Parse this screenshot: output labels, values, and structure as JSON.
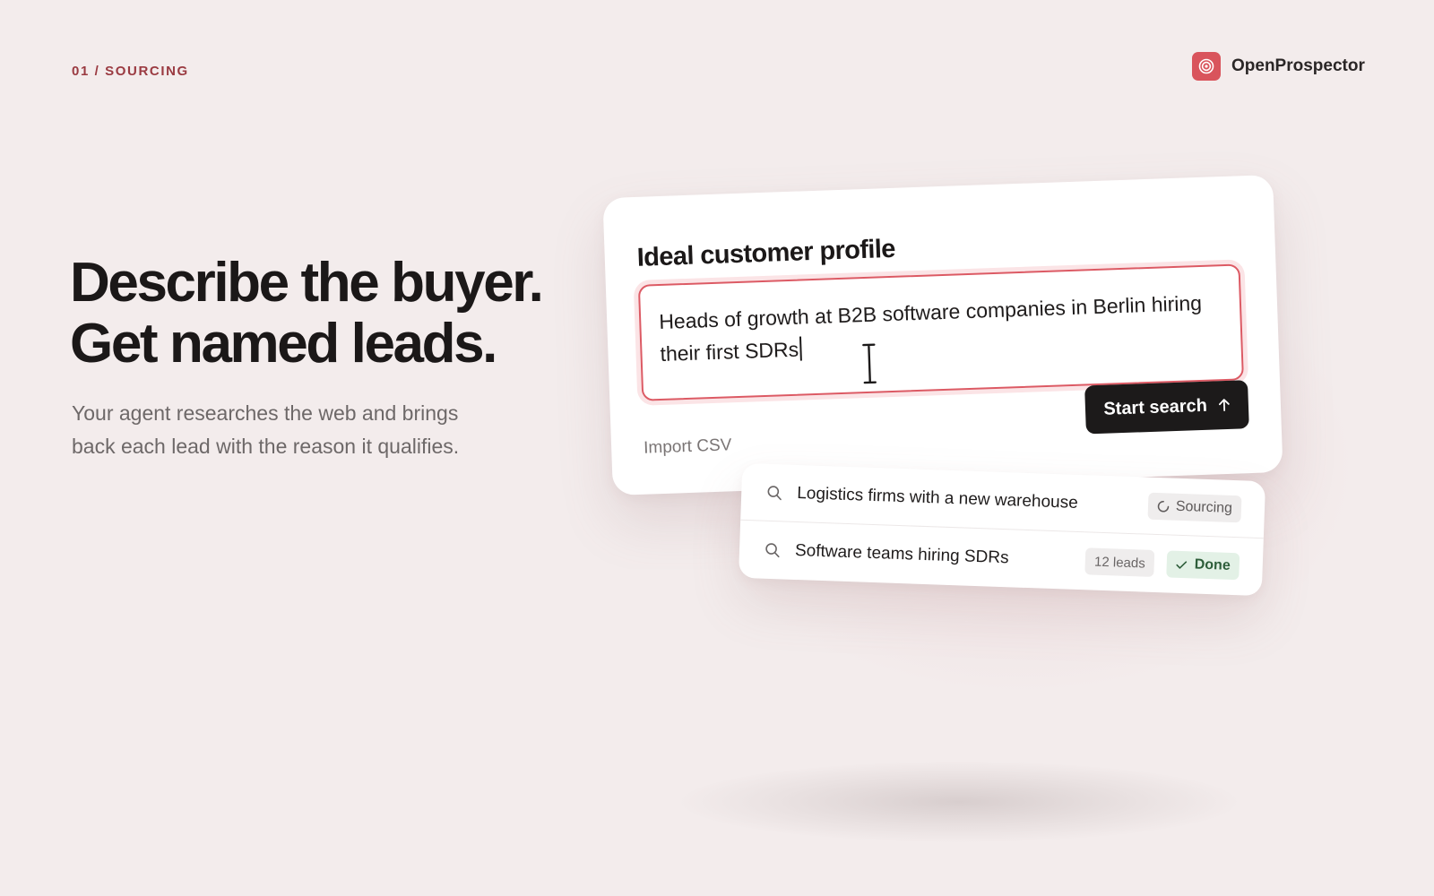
{
  "header": {
    "eyebrow": "01 / SOURCING",
    "brand_name": "OpenProspector",
    "brand_icon": "target-icon",
    "brand_color": "#d9545c"
  },
  "hero": {
    "headline_line1": "Describe the buyer.",
    "headline_line2": "Get named leads.",
    "subcopy": "Your agent researches the web and brings back each lead with the reason it qualifies."
  },
  "icp_card": {
    "title": "Ideal customer profile",
    "input_value": "Heads of growth at B2B software companies in Berlin hiring their first SDRs",
    "import_label": "Import CSV",
    "start_label": "Start search",
    "start_icon": "arrow-up-icon",
    "accent_color": "#dc5a64"
  },
  "searches": [
    {
      "query": "Logistics firms with a new warehouse",
      "status": "Sourcing",
      "status_icon": "spinner-icon"
    },
    {
      "query": "Software teams hiring SDRs",
      "count": "12 leads",
      "status": "Done",
      "status_icon": "check-icon",
      "status_color": "#2e5e3a"
    }
  ]
}
